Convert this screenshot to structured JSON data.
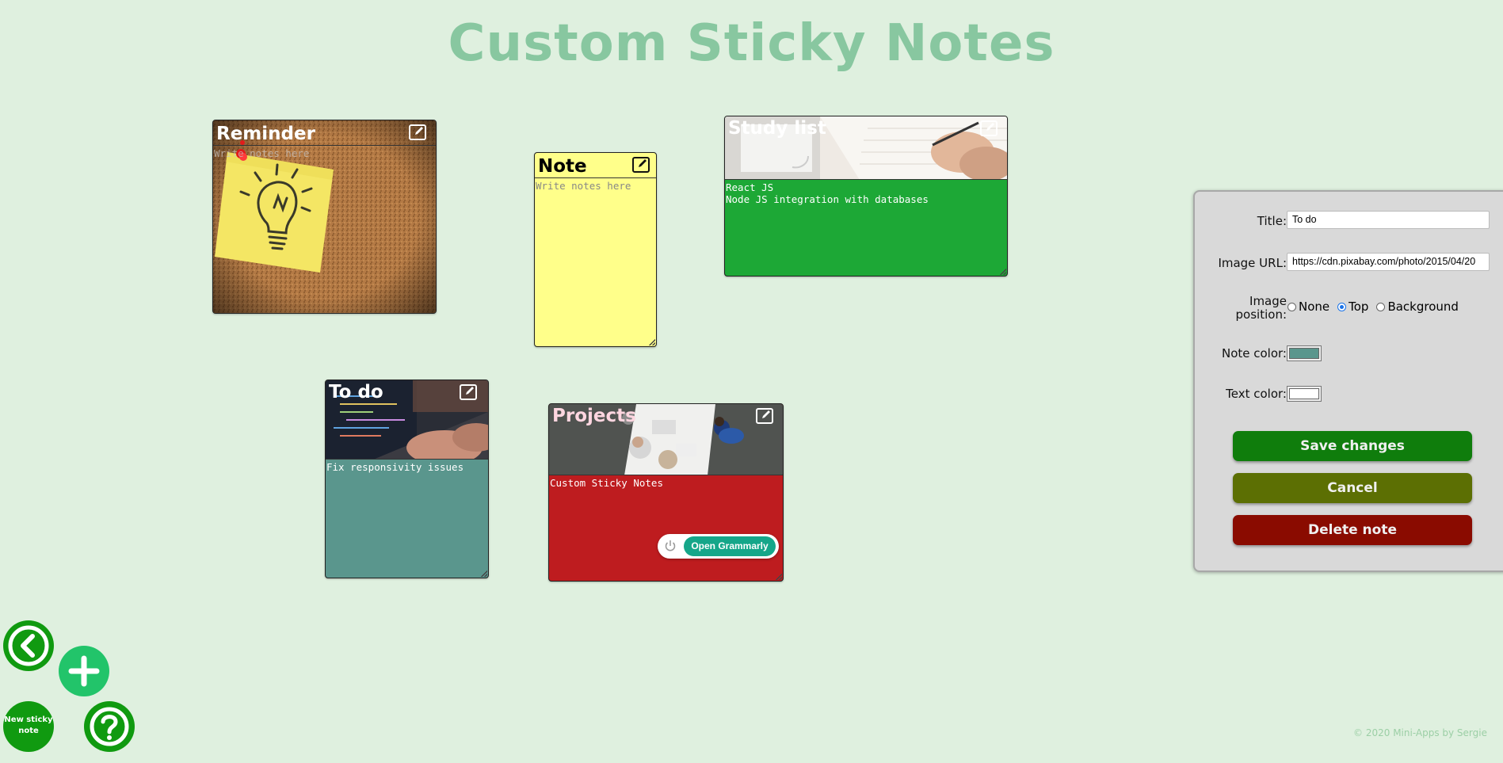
{
  "app": {
    "title": "Custom Sticky Notes"
  },
  "notes": [
    {
      "title": "Reminder",
      "body": "",
      "placeholder": "Write notes here",
      "image_position": "background",
      "image": "lightbulb-sticky-note-on-corkboard",
      "text_color": "#ffffff",
      "note_color": "#b67a3f"
    },
    {
      "title": "Note",
      "body": "",
      "placeholder": "Write notes here",
      "image_position": "none",
      "text_color": "#000000",
      "note_color": "#ffff8a"
    },
    {
      "title": "Study list",
      "body": "React JS\nNode JS integration with databases",
      "image_position": "top",
      "image": "hand-writing-in-notebook",
      "text_color": "#ffffff",
      "note_color": "#1da836"
    },
    {
      "title": "To do",
      "body": "Fix responsivity issues",
      "image_position": "top",
      "image": "hands-typing-on-laptop",
      "text_color": "#ffffff",
      "note_color": "#5a968d"
    },
    {
      "title": "Projects",
      "body": "Custom Sticky Notes",
      "image_position": "top",
      "image": "team-meeting-at-table",
      "text_color": "#ffd6e0",
      "note_color": "#be1c1f"
    }
  ],
  "grammarly": {
    "label": "Open Grammarly"
  },
  "editor": {
    "title_label": "Title:",
    "title_value": "To do",
    "image_url_label": "Image URL:",
    "image_url_value": "https://cdn.pixabay.com/photo/2015/04/20",
    "image_position_label": "Image position:",
    "image_position_options": [
      "None",
      "Top",
      "Background"
    ],
    "image_position_selected": "Top",
    "note_color_label": "Note color:",
    "note_color_value": "#5a968d",
    "text_color_label": "Text color:",
    "text_color_value": "#ffffff",
    "save_label": "Save changes",
    "cancel_label": "Cancel",
    "delete_label": "Delete note"
  },
  "controls": {
    "new_note_label": "New sticky note"
  },
  "footer": {
    "text": "© 2020 Mini-Apps by Sergie"
  },
  "colors": {
    "background": "#dff0df",
    "title": "#88c7a0",
    "save": "#0f7d0c",
    "cancel": "#5c6f03",
    "delete": "#8a0b00",
    "fab": "#109a10",
    "fab_light": "#22c46a"
  }
}
